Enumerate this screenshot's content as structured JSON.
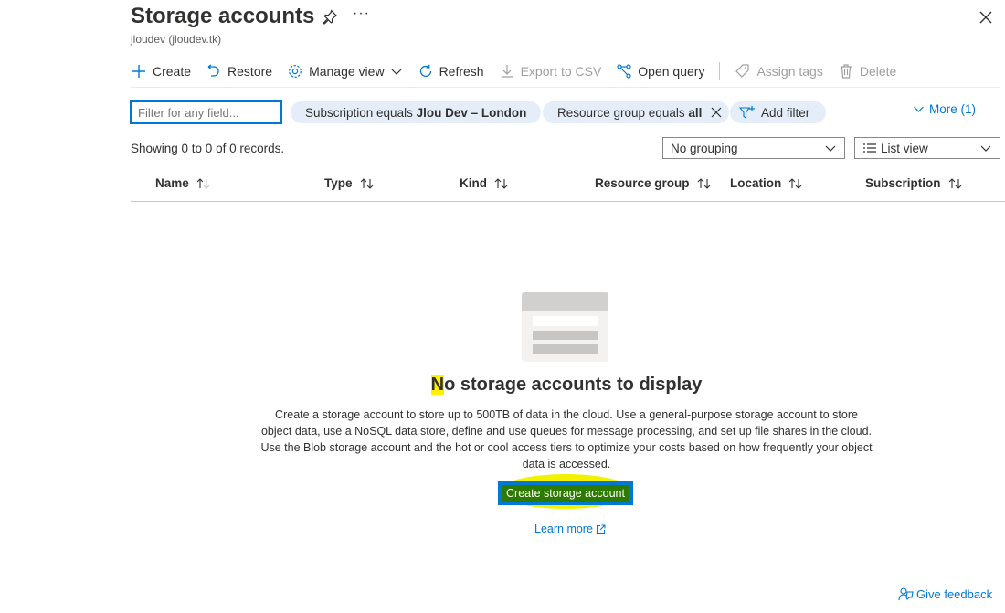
{
  "header": {
    "title": "Storage accounts",
    "subtitle": "jloudev (jloudev.tk)",
    "more_label": "···"
  },
  "toolbar": {
    "create": "Create",
    "restore": "Restore",
    "manage_view": "Manage view",
    "refresh": "Refresh",
    "export_csv": "Export to CSV",
    "open_query": "Open query",
    "assign_tags": "Assign tags",
    "delete": "Delete"
  },
  "filters": {
    "search_placeholder": "Filter for any field...",
    "subscription_prefix": "Subscription equals ",
    "subscription_value": "Jlou Dev – London",
    "resource_group_prefix": "Resource group equals ",
    "resource_group_value": "all",
    "add_filter": "Add filter",
    "more": "More (1)"
  },
  "records": {
    "summary": "Showing 0 to 0 of 0 records.",
    "grouping": "No grouping",
    "view": "List view"
  },
  "columns": [
    "Name",
    "Type",
    "Kind",
    "Resource group",
    "Location",
    "Subscription"
  ],
  "empty_state": {
    "title_first_letter": "N",
    "title_rest": "o storage accounts to display",
    "description": "Create a storage account to store up to 500TB of data in the cloud. Use a general-purpose storage account to store object data, use a NoSQL data store, define and use queues for message processing, and set up file shares in the cloud. Use the Blob storage account and the hot or cool access tiers to optimize your costs based on how frequently your object data is accessed.",
    "create_button": "Create storage account",
    "learn_more": "Learn more"
  },
  "footer": {
    "feedback": "Give feedback"
  },
  "colors": {
    "accent": "#0078d4",
    "pill_bg": "#e5eef8",
    "highlight": "#fff200"
  }
}
